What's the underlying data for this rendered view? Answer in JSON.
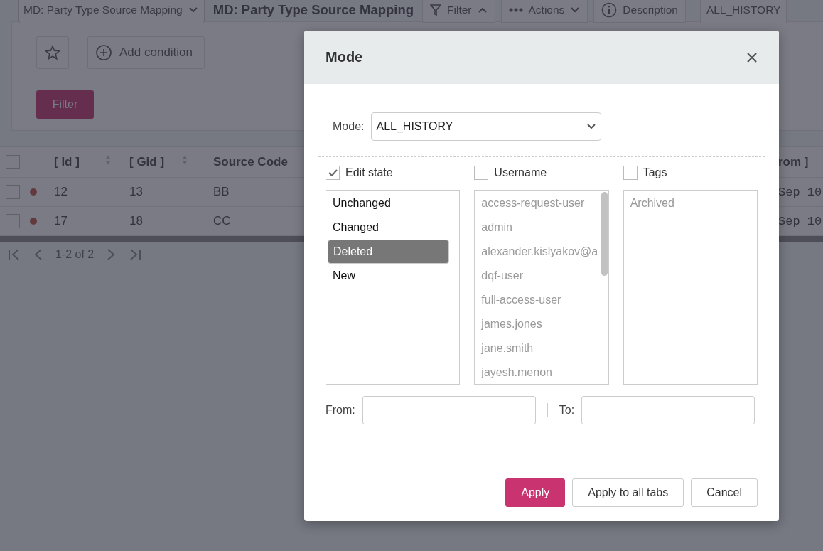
{
  "app": {
    "module_select": "MD: Party Type Source Mapping",
    "title": "MD: Party Type Source Mapping",
    "toolbar": [
      {
        "kind": "filter",
        "label": "Filter",
        "expanded": true
      },
      {
        "kind": "actions",
        "label": "Actions",
        "expanded": false
      },
      {
        "kind": "description",
        "label": "Description"
      }
    ],
    "mode_badge": "ALL_HISTORY"
  },
  "filter_panel": {
    "add_condition": "Add condition",
    "filter_button": "Filter"
  },
  "table": {
    "columns": [
      {
        "label": "[ Id ]",
        "sortable": true
      },
      {
        "label": "[ Gid ]",
        "sortable": true
      },
      {
        "label": "Source Code",
        "sortable": false
      },
      {
        "label": "rom ]",
        "sortable": false
      }
    ],
    "all_checked": false,
    "rows": [
      {
        "checked": false,
        "cells": [
          "12",
          "13",
          "BB",
          "Sep 10"
        ]
      },
      {
        "checked": false,
        "cells": [
          "17",
          "18",
          "CC",
          "Sep 10"
        ]
      }
    ],
    "pager": "1-2 of 2"
  },
  "dialog": {
    "title": "Mode",
    "mode_label": "Mode:",
    "mode_value": "ALL_HISTORY",
    "groups": [
      {
        "label": "Edit state",
        "checked": true,
        "scrollbar": false,
        "items": [
          {
            "label": "Unchanged",
            "selected": false
          },
          {
            "label": "Changed",
            "selected": false
          },
          {
            "label": "Deleted",
            "selected": true
          },
          {
            "label": "New",
            "selected": false
          }
        ]
      },
      {
        "label": "Username",
        "checked": false,
        "scrollbar": true,
        "items": [
          {
            "label": "access-request-user",
            "selected": false
          },
          {
            "label": "admin",
            "selected": false
          },
          {
            "label": "alexander.kislyakov@a",
            "selected": false
          },
          {
            "label": "dqf-user",
            "selected": false
          },
          {
            "label": "full-access-user",
            "selected": false
          },
          {
            "label": "james.jones",
            "selected": false
          },
          {
            "label": "jane.smith",
            "selected": false
          },
          {
            "label": "jayesh.menon",
            "selected": false
          }
        ]
      },
      {
        "label": "Tags",
        "checked": false,
        "scrollbar": false,
        "items": [
          {
            "label": "Archived",
            "selected": false
          }
        ]
      }
    ],
    "from_label": "From:",
    "to_label": "To:",
    "buttons": [
      {
        "label": "Apply",
        "kind": "primary"
      },
      {
        "label": "Apply to all tabs",
        "kind": "secondary"
      },
      {
        "label": "Cancel",
        "kind": "secondary"
      }
    ]
  }
}
